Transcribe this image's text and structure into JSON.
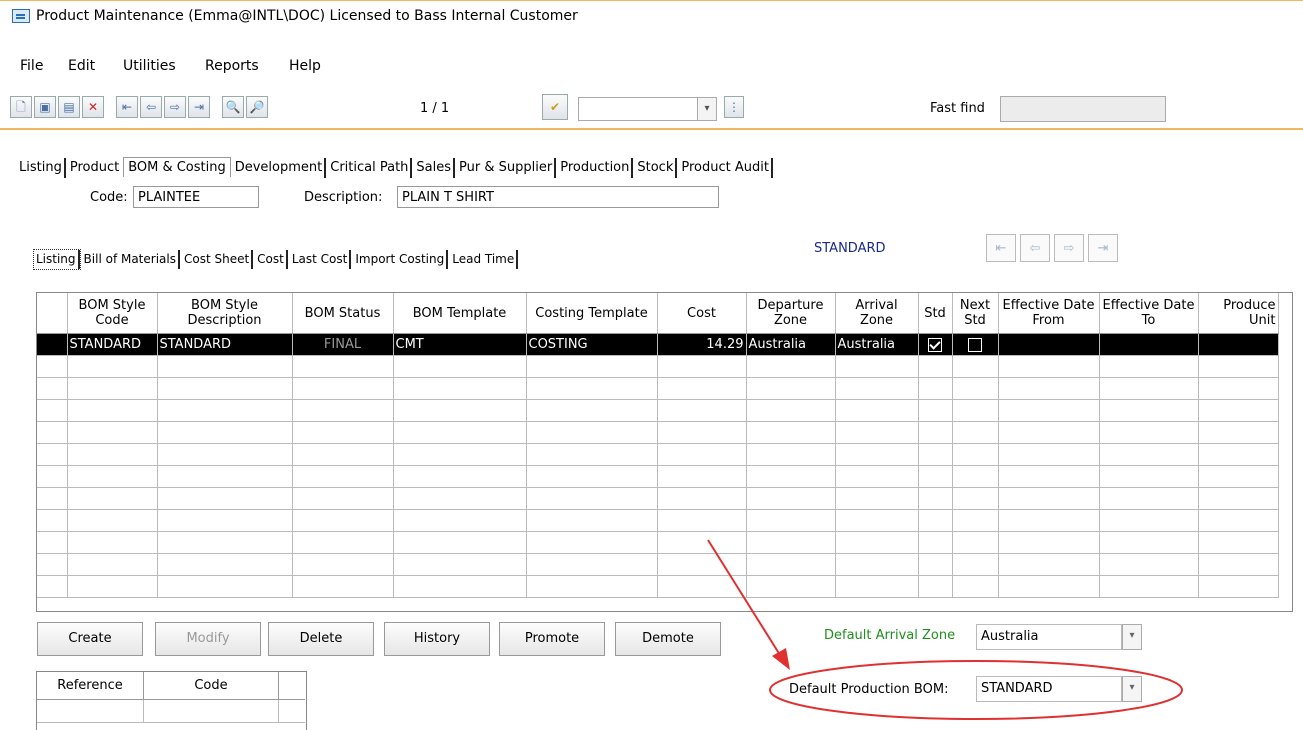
{
  "window": {
    "title": "Product Maintenance (Emma@INTL\\DOC) Licensed to Bass Internal Customer"
  },
  "menu": [
    "File",
    "Edit",
    "Utilities",
    "Reports",
    "Help"
  ],
  "toolbar": {
    "record_counter": "1 / 1",
    "fast_find_label": "Fast find",
    "fast_find_value": "",
    "combo_value": ""
  },
  "main_tabs": [
    "Listing",
    "Product",
    "BOM & Costing",
    "Development",
    "Critical Path",
    "Sales",
    "Pur & Supplier",
    "Production",
    "Stock",
    "Product Audit"
  ],
  "product": {
    "code_label": "Code:",
    "code": "PLAINTEE",
    "description_label": "Description:",
    "description": "PLAIN T SHIRT"
  },
  "sub_tabs": [
    "Listing",
    "Bill of Materials",
    "Cost Sheet",
    "Cost",
    "Last Cost",
    "Import Costing",
    "Lead Time"
  ],
  "current_bom": "STANDARD",
  "grid": {
    "columns": [
      "BOM Style Code",
      "BOM Style Description",
      "BOM Status",
      "BOM Template",
      "Costing Template",
      "Cost",
      "Departure Zone",
      "Arrival Zone",
      "Std",
      "Next Std",
      "Effective Date From",
      "Effective Date To",
      "Produce Unit"
    ],
    "rows": [
      {
        "code": "STANDARD",
        "description": "STANDARD",
        "status": "FINAL",
        "bom_template": "CMT",
        "costing_template": "COSTING",
        "cost": "14.29",
        "departure_zone": "Australia",
        "arrival_zone": "Australia",
        "std": true,
        "next_std": false,
        "date_from": "",
        "date_to": "",
        "produce_unit": ""
      }
    ]
  },
  "buttons": [
    "Create",
    "Modify",
    "Delete",
    "History",
    "Promote",
    "Demote"
  ],
  "reference_grid": {
    "columns": [
      "Reference",
      "Code"
    ]
  },
  "defaults": {
    "arrival_zone_label": "Default Arrival Zone",
    "arrival_zone": "Australia",
    "production_bom_label": "Default Production BOM:",
    "production_bom": "STANDARD"
  },
  "annotation_color": "#e03030"
}
